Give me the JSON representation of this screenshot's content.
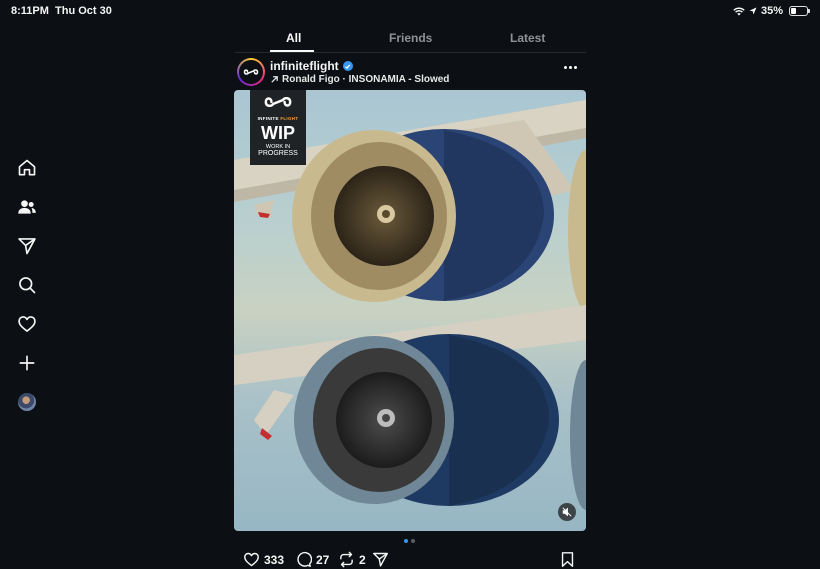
{
  "status_bar": {
    "time": "8:11PM",
    "date": "Thu Oct 30",
    "battery": "35%",
    "battery_level": 0.35
  },
  "sidebar": {
    "items": [
      {
        "icon": "home-icon"
      },
      {
        "icon": "people-icon"
      },
      {
        "icon": "send-icon"
      },
      {
        "icon": "search-icon"
      },
      {
        "icon": "heart-icon"
      },
      {
        "icon": "plus-icon"
      },
      {
        "icon": "profile-avatar"
      }
    ]
  },
  "feed_tabs": [
    {
      "label": "All",
      "active": true
    },
    {
      "label": "Friends",
      "active": false
    },
    {
      "label": "Latest",
      "active": false
    }
  ],
  "post": {
    "username": "infiniteflight",
    "verified": true,
    "audio": "Ronald Figo · INSONAMIA - Slowed",
    "media": {
      "badge_brand_1": "INFINITE ",
      "badge_brand_2": "FLIGHT",
      "badge_title": "WIP",
      "badge_sub_1": "WORK IN",
      "badge_sub_2": "PROGRESS",
      "muted": true
    },
    "carousel": {
      "count": 2,
      "current": 1
    },
    "actions": {
      "likes": "333",
      "comments": "27",
      "reposts": "2"
    }
  },
  "colors": {
    "background": "#0c1014",
    "accent": "#3797f0",
    "verified": "#3797f0"
  }
}
